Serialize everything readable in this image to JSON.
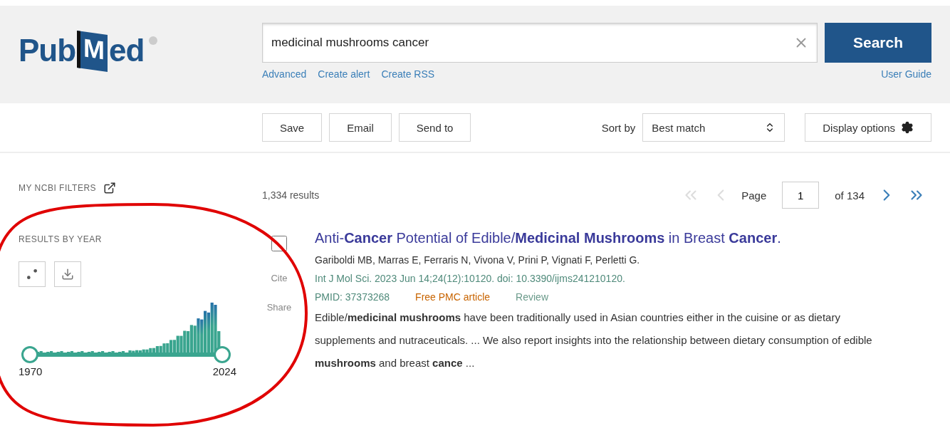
{
  "logo": {
    "parts": [
      "Pub",
      "M",
      "ed"
    ]
  },
  "search": {
    "value": "medicinal mushrooms cancer",
    "button": "Search",
    "links": [
      "Advanced",
      "Create alert",
      "Create RSS"
    ],
    "user_guide": "User Guide"
  },
  "actions": [
    "Save",
    "Email",
    "Send to"
  ],
  "sort": {
    "label": "Sort by",
    "value": "Best match"
  },
  "display_options": "Display options",
  "sidebar": {
    "filters_title": "MY NCBI FILTERS",
    "results_by_year": "RESULTS BY YEAR",
    "timeline": {
      "start": "1970",
      "end": "2024"
    }
  },
  "results_count": "1,334 results",
  "pagination": {
    "label": "Page",
    "page": "1",
    "total": "of 134",
    "prev_disabled": true,
    "next_disabled": false
  },
  "results": [
    {
      "checked": false,
      "title": "Anti-**Cancer** Potential of Edible/**Medicinal Mushrooms** in Breast **Cancer**.",
      "authors": "Gariboldi MB, Marras E, Ferraris N, Vivona V, Prini P, Vignati F, Perletti G.",
      "citation": "Int J Mol Sci. 2023 Jun 14;24(12):10120. doi: 10.3390/ijms241210120.",
      "pmid": "PMID: 37373268",
      "badges": [
        {
          "text": "Free PMC article",
          "kind": "free"
        },
        {
          "text": "Review",
          "kind": "type"
        }
      ],
      "snippet": "Edible/**medicinal mushrooms** have been traditionally used in Asian countries either in the cuisine or as dietary supplements and nutraceuticals. ... We also report insights into the relationship between dietary consumption of edible **mushrooms** and breast **cance** ...",
      "actions": [
        "Cite",
        "Share"
      ]
    }
  ],
  "annotation": {
    "kind": "ellipse"
  }
}
